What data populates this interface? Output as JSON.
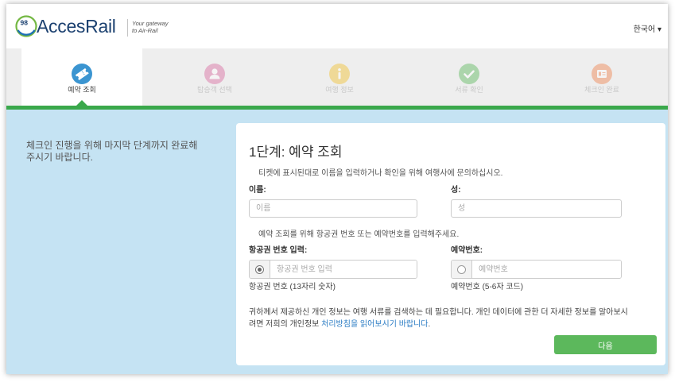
{
  "header": {
    "logo_badge": "98",
    "brand": {
      "part1": "Acces",
      "part2": "Rail"
    },
    "tagline": {
      "line1": "Your gateway",
      "line2": "to Air-Rail"
    },
    "language": {
      "label": "한국어",
      "caret": "▾"
    }
  },
  "steps": [
    {
      "label": "예약 조회",
      "icon": "ticket-icon",
      "color": "#3b95d1",
      "active": true
    },
    {
      "label": "탑승객 선택",
      "icon": "person-icon",
      "color": "#d96aa0",
      "active": false
    },
    {
      "label": "여행 정보",
      "icon": "info-icon",
      "color": "#f2c12e",
      "active": false
    },
    {
      "label": "서류 확인",
      "icon": "check-icon",
      "color": "#5cb85c",
      "active": false
    },
    {
      "label": "체크인 완료",
      "icon": "boarding-pass-icon",
      "color": "#f0834f",
      "active": false
    }
  ],
  "colors": {
    "accent_green": "#3aa84b",
    "content_background": "#c5e3f3",
    "next_button": "#5cb85c",
    "link": "#2b7cc4"
  },
  "intro": {
    "line1": "체크인 진행을 위해 마지막 단계까지 완료해",
    "line2": "주시기 바랍니다."
  },
  "form": {
    "title": "1단계: 예약 조회",
    "name_instruction": "티켓에 표시된대로 이름을 입력하거나 확인을 위해 여행사에 문의하십시오.",
    "first_name": {
      "label": "이름:",
      "placeholder": "이름",
      "value": ""
    },
    "last_name": {
      "label": "성:",
      "placeholder": "성",
      "value": ""
    },
    "lookup_instruction": "예약 조회를 위해 항공권 번호 또는 예약번호를 입력해주세요.",
    "ticket_number": {
      "label": "항공권 번호 입력:",
      "placeholder": "항공권 번호 입력",
      "value": "",
      "selected": true,
      "help": "항공권 번호 (13자리 숫자)"
    },
    "booking_reference": {
      "label": "예약번호:",
      "placeholder": "예약번호",
      "value": "",
      "selected": false,
      "help": "예약번호 (5-6자 코드)"
    },
    "privacy": {
      "line1": "귀하께서 제공하신 개인 정보는 여행 서류를 검색하는 데 필요합니다. 개인 데이터에 관한 더 자세한 정보를 알아보시",
      "line2_prefix": "려면 저희의 개인정보 ",
      "line2_link": "처리방침을 읽어보시기 바랍니다",
      "line2_suffix": "."
    },
    "next_button": "다음"
  }
}
